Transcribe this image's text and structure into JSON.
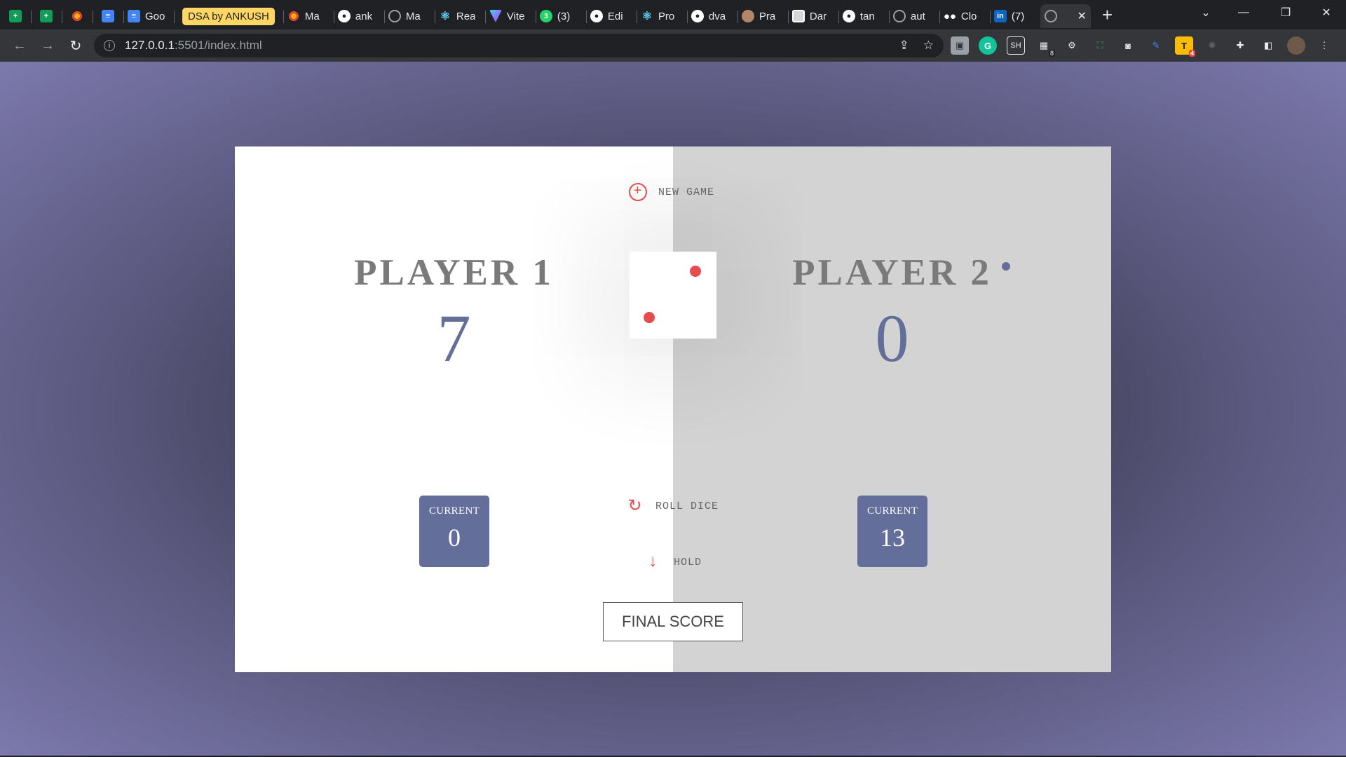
{
  "browser": {
    "tabs": [
      {
        "title": "",
        "icon": "google-sheets-icon"
      },
      {
        "title": "",
        "icon": "google-sheets-icon"
      },
      {
        "title": "",
        "icon": "flower-icon"
      },
      {
        "title": "",
        "icon": "google-docs-icon"
      },
      {
        "title": "Goo",
        "icon": "google-docs-icon"
      },
      {
        "title": "DSA by ANKUSH",
        "icon": "tab-group-label"
      },
      {
        "title": "Ma",
        "icon": "flower-icon"
      },
      {
        "title": "ank",
        "icon": "github-icon"
      },
      {
        "title": "Ma",
        "icon": "globe-icon"
      },
      {
        "title": "Rea",
        "icon": "react-icon"
      },
      {
        "title": "Vite",
        "icon": "vite-icon"
      },
      {
        "title": "(3)",
        "icon": "whatsapp-icon"
      },
      {
        "title": "Edi",
        "icon": "github-icon"
      },
      {
        "title": "Pro",
        "icon": "react-icon"
      },
      {
        "title": "dva",
        "icon": "github-icon"
      },
      {
        "title": "Pra",
        "icon": "avatar-icon"
      },
      {
        "title": "Dar",
        "icon": "avatar-icon"
      },
      {
        "title": "tan",
        "icon": "github-icon"
      },
      {
        "title": "aut",
        "icon": "globe-icon"
      },
      {
        "title": "Clo",
        "icon": "medium-icon"
      },
      {
        "title": "(7)",
        "icon": "linkedin-icon"
      },
      {
        "title": "",
        "icon": "globe-icon",
        "active": true
      }
    ],
    "whatsapp_badge": "3",
    "url_host": "127.0.0.1",
    "url_rest": ":5501/index.html",
    "extension_badges": {
      "puzzle": "8",
      "tasks": "4"
    },
    "extension_labels": {
      "sh": "SH",
      "t": "T"
    }
  },
  "game": {
    "new_game_label": "NEW GAME",
    "roll_dice_label": "ROLL DICE",
    "hold_label": "HOLD",
    "final_score_label": "FINAL SCORE",
    "dice_value": 2,
    "active_player": 2,
    "colors": {
      "accent": "#e74c4c",
      "score": "#636e9a",
      "active_panel": "#d3d3d3",
      "inactive_panel": "#ffffff"
    },
    "players": [
      {
        "name": "PLAYER 1",
        "score": "7",
        "current_label": "CURRENT",
        "current": "0"
      },
      {
        "name": "PLAYER 2",
        "score": "0",
        "current_label": "CURRENT",
        "current": "13"
      }
    ]
  }
}
